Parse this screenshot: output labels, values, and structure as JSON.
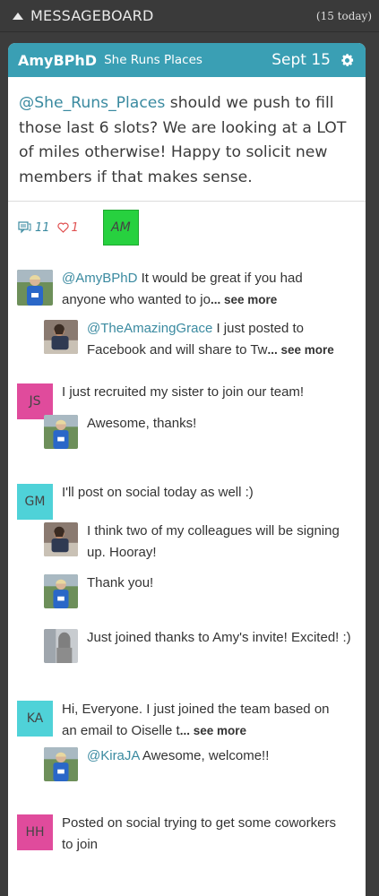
{
  "header": {
    "title": "MESSAGEBOARD",
    "count": "(15 today)"
  },
  "post": {
    "author": "AmyBPhD",
    "handle": "She Runs Places",
    "date": "Sept 15",
    "mention": "@She_Runs_Places",
    "body": " should we push to fill those last 6 slots? We are looking at a LOT of miles otherwise! Happy to solicit new members if that makes sense.",
    "comments_count": "11",
    "likes_count": "1",
    "avatar_initials": "AM"
  },
  "comments": [
    {
      "avatar": "photo-runner-blue",
      "mention": "@AmyBPhD",
      "text": " It would be great if you had anyone who wanted to jo",
      "more": "... see more",
      "replies": [
        {
          "avatar": "photo-runner-dark",
          "mention": "@TheAmazingGrace",
          "text": " I just posted to Facebook and will share to Tw",
          "more": "... see more"
        }
      ]
    },
    {
      "initials": "JS",
      "color": "#e04b9c",
      "text": "I just recruited my sister to join our team!",
      "replies": [
        {
          "avatar": "photo-runner-blue",
          "text": "Awesome, thanks!"
        }
      ]
    },
    {
      "initials": "GM",
      "color": "#4fd2d8",
      "text": "I'll post on social today as well :)",
      "replies": [
        {
          "avatar": "photo-runner-dark",
          "text": "I think two of my colleagues will be signing up. Hooray!"
        },
        {
          "avatar": "photo-runner-blue",
          "text": "Thank you!"
        },
        {
          "avatar": "photo-person-grey",
          "text": "Just joined thanks to Amy's invite! Excited! :)"
        }
      ]
    },
    {
      "initials": "KA",
      "color": "#4fd2d8",
      "text": "Hi, Everyone. I just joined the team based on an email to Oiselle t",
      "more": "... see more",
      "replies": [
        {
          "avatar": "photo-runner-blue",
          "mention": "@KiraJA",
          "text": " Awesome, welcome!!"
        }
      ]
    },
    {
      "initials": "HH",
      "color": "#e04b9c",
      "text": "Posted on social trying to get some coworkers to join"
    }
  ]
}
